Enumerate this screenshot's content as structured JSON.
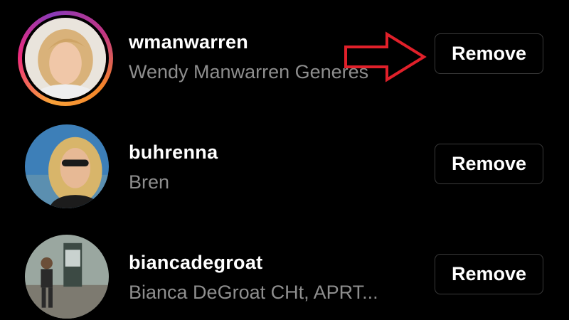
{
  "followers": [
    {
      "username": "wmanwarren",
      "full_name": "Wendy Manwarren Generes",
      "has_story": true,
      "remove_label": "Remove"
    },
    {
      "username": "buhrenna",
      "full_name": "Bren",
      "has_story": false,
      "remove_label": "Remove"
    },
    {
      "username": "biancadegroat",
      "full_name": "Bianca DeGroat CHt, APRT...",
      "has_story": false,
      "remove_label": "Remove"
    }
  ],
  "annotation": {
    "type": "arrow",
    "color": "#e0202a",
    "points_to": "remove-button"
  },
  "colors": {
    "background": "#000000",
    "username": "#ffffff",
    "full_name": "#8e8e8e",
    "button_border": "#3a3a3a"
  }
}
